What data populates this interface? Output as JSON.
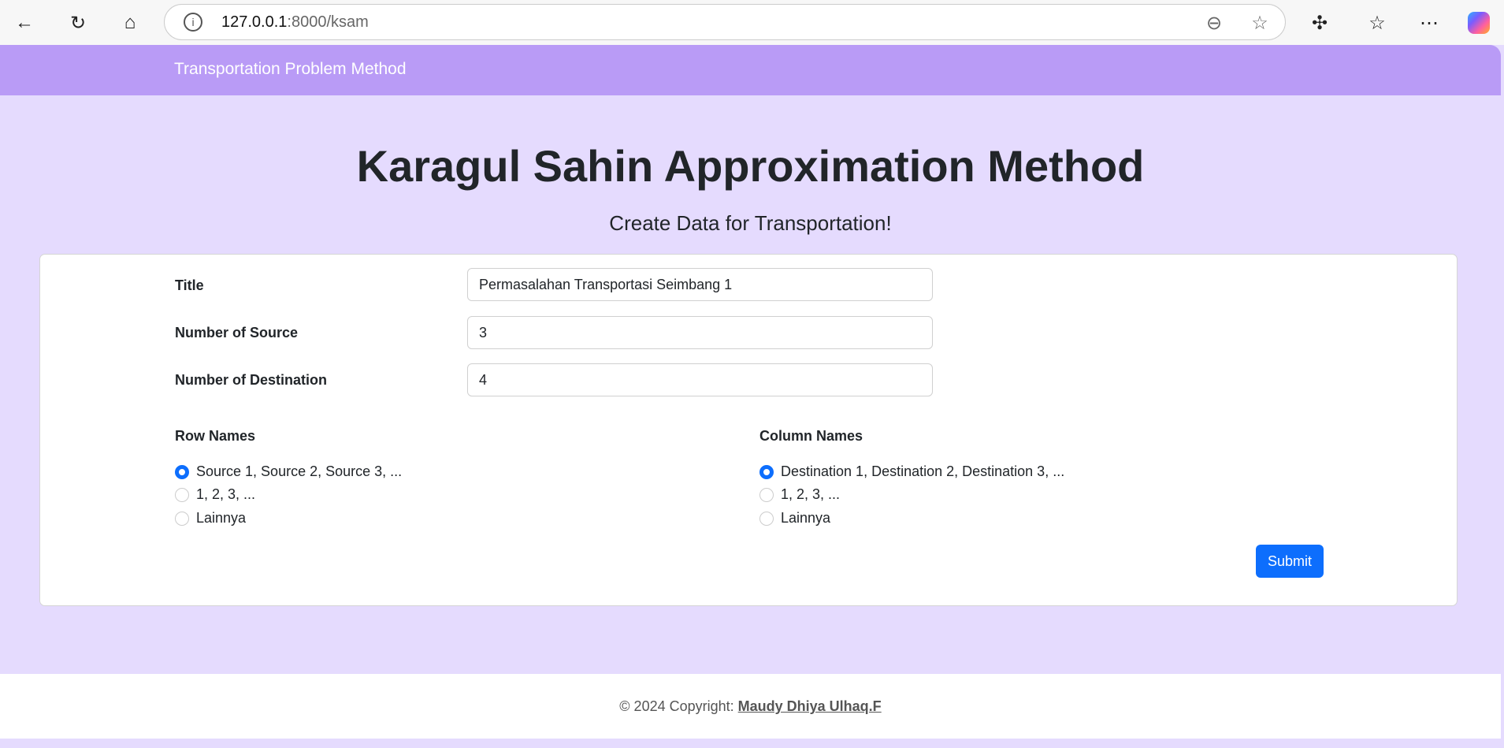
{
  "browser": {
    "url_host": "127.0.0.1",
    "url_path": ":8000/ksam"
  },
  "navbar": {
    "brand": "Transportation Problem Method"
  },
  "header": {
    "title": "Karagul Sahin Approximation Method",
    "subtitle": "Create Data for Transportation!"
  },
  "form": {
    "title_label": "Title",
    "title_value": "Permasalahan Transportasi Seimbang 1",
    "source_label": "Number of Source",
    "source_value": "3",
    "dest_label": "Number of Destination",
    "dest_value": "4",
    "row_names": {
      "label": "Row Names",
      "options": [
        "Source 1, Source 2, Source 3, ...",
        "1, 2, 3, ...",
        "Lainnya"
      ],
      "selected": 0
    },
    "column_names": {
      "label": "Column Names",
      "options": [
        "Destination 1, Destination 2, Destination 3, ...",
        "1, 2, 3, ...",
        "Lainnya"
      ],
      "selected": 0
    },
    "submit": "Submit"
  },
  "footer": {
    "text": "© 2024 Copyright: ",
    "author": "Maudy Dhiya Ulhaq.F"
  }
}
